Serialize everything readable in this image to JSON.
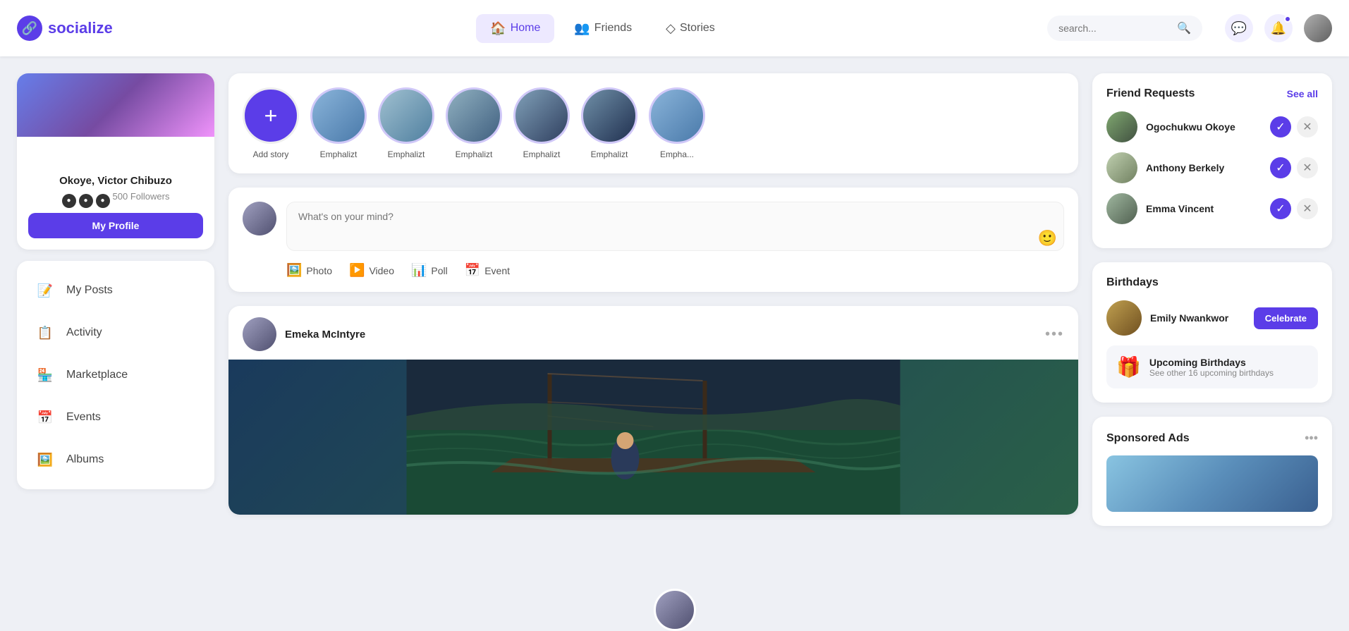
{
  "app": {
    "name": "socialize",
    "logo_icon": "🔗"
  },
  "header": {
    "nav": [
      {
        "id": "home",
        "label": "Home",
        "icon": "🏠",
        "active": true
      },
      {
        "id": "friends",
        "label": "Friends",
        "icon": "👥",
        "active": false
      },
      {
        "id": "stories",
        "label": "Stories",
        "icon": "◇",
        "active": false
      }
    ],
    "search_placeholder": "search...",
    "search_icon": "🔍",
    "messages_icon": "💬",
    "notifications_icon": "🔔"
  },
  "left_sidebar": {
    "profile": {
      "name": "Okoye, Victor Chibuzo",
      "followers": "500 Followers",
      "my_profile_label": "My Profile"
    },
    "nav_items": [
      {
        "id": "my-posts",
        "label": "My Posts",
        "icon": "📝"
      },
      {
        "id": "activity",
        "label": "Activity",
        "icon": "📋"
      },
      {
        "id": "marketplace",
        "label": "Marketplace",
        "icon": "🏪"
      },
      {
        "id": "events",
        "label": "Events",
        "icon": "📅"
      },
      {
        "id": "albums",
        "label": "Albums",
        "icon": "🖼️"
      }
    ]
  },
  "stories": {
    "add_story_label": "Add story",
    "items": [
      {
        "label": "Emphalizt"
      },
      {
        "label": "Emphalizt"
      },
      {
        "label": "Emphalizt"
      },
      {
        "label": "Emphalizt"
      },
      {
        "label": "Emphalizt"
      },
      {
        "label": "Empha..."
      }
    ]
  },
  "composer": {
    "placeholder": "What's on your mind?",
    "emoji": "🙂",
    "actions": [
      {
        "id": "photo",
        "label": "Photo",
        "icon": "🖼️"
      },
      {
        "id": "video",
        "label": "Video",
        "icon": "▶️"
      },
      {
        "id": "poll",
        "label": "Poll",
        "icon": "📊"
      },
      {
        "id": "event",
        "label": "Event",
        "icon": "📅"
      }
    ]
  },
  "feed": {
    "posts": [
      {
        "author": "Emeka McIntyre",
        "more_icon": "•••"
      }
    ]
  },
  "right_sidebar": {
    "friend_requests": {
      "title": "Friend Requests",
      "see_all": "See all",
      "items": [
        {
          "name": "Ogochukwu Okoye"
        },
        {
          "name": "Anthony Berkely"
        },
        {
          "name": "Emma Vincent"
        }
      ]
    },
    "birthdays": {
      "title": "Birthdays",
      "celebrate_btn": "Celebrate",
      "featured": {
        "name": "Emily Nwankwor"
      },
      "upcoming": {
        "title": "Upcoming Birthdays",
        "subtitle": "See other 16 upcoming birthdays",
        "icon": "🎁"
      }
    },
    "sponsored_ads": {
      "title": "Sponsored Ads",
      "more_icon": "•••"
    }
  }
}
